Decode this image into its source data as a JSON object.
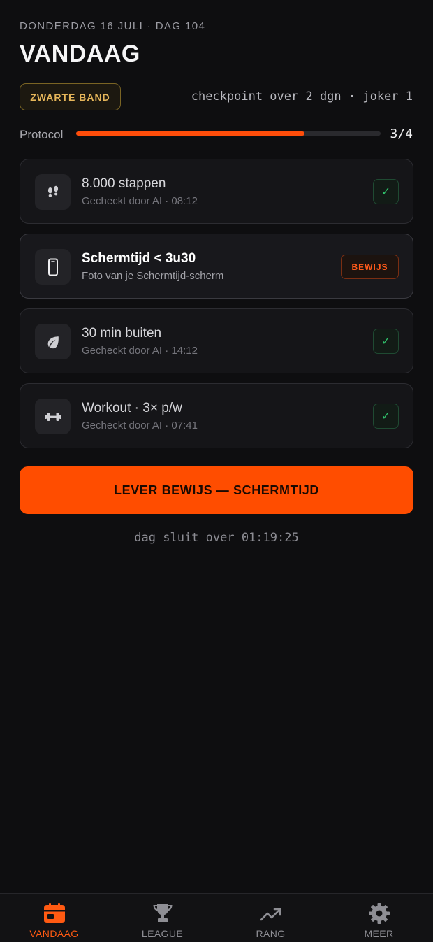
{
  "header": {
    "date": "DONDERDAG 16 JULI · DAG 104",
    "title": "VANDAAG",
    "badge": "ZWARTE BAND",
    "checkpoint": "checkpoint over 2 dgn · joker 1"
  },
  "protocol": {
    "label": "Protocol",
    "done": 3,
    "total": 4,
    "count_text": "3/4"
  },
  "tasks": [
    {
      "title": "8.000 stappen",
      "subtitle": "Gecheckt door AI · 08:12",
      "status": "done",
      "check": "✓",
      "icon": "footsteps-icon"
    },
    {
      "title": "Schermtijd < 3u30",
      "subtitle": "Foto van je Schermtijd-scherm",
      "status": "needs-proof",
      "action": "BEWIJS",
      "icon": "phone-icon"
    },
    {
      "title": "30 min buiten",
      "subtitle": "Gecheckt door AI · 14:12",
      "status": "done",
      "check": "✓",
      "icon": "leaf-icon"
    },
    {
      "title": "Workout · 3× p/w",
      "subtitle": "Gecheckt door AI · 07:41",
      "status": "done",
      "check": "✓",
      "icon": "dumbbell-icon"
    }
  ],
  "cta": {
    "label": "LEVER BEWIJS — SCHERMTIJD"
  },
  "day_closes": "dag sluit over 01:19:25",
  "nav": [
    {
      "label": "VANDAAG",
      "icon": "calendar-icon",
      "active": true
    },
    {
      "label": "LEAGUE",
      "icon": "trophy-icon",
      "active": false
    },
    {
      "label": "RANG",
      "icon": "trending-up-icon",
      "active": false
    },
    {
      "label": "MEER",
      "icon": "gear-icon",
      "active": false
    }
  ],
  "colors": {
    "accent": "#ff4d00",
    "background": "#0e0e10",
    "success": "#2fbf6a",
    "gold": "#e6b65a"
  }
}
